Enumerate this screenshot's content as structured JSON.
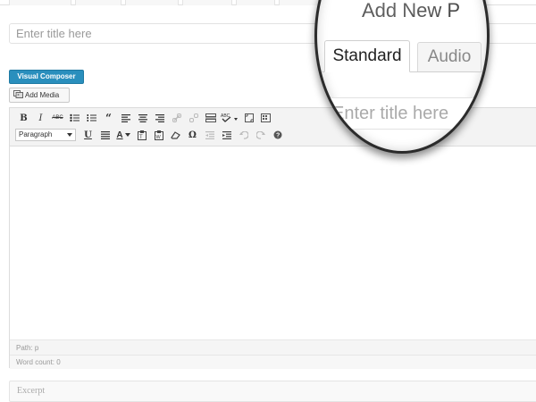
{
  "post": {
    "title_placeholder": "Enter title here",
    "visual_composer_label": "Visual Composer",
    "add_media_label": "Add Media"
  },
  "toolbar": {
    "row1": [
      "bold",
      "italic",
      "strikethrough",
      "bullet-list",
      "numbered-list",
      "blockquote",
      "align-left",
      "align-center",
      "align-right",
      "insert-link",
      "remove-link",
      "insert-more",
      "spellcheck",
      "fullscreen",
      "toolbar-toggle"
    ],
    "row2": [
      "format-select",
      "underline",
      "justify",
      "text-color",
      "paste-as-text",
      "paste-from-word",
      "clear-formatting",
      "special-character",
      "outdent",
      "indent",
      "undo",
      "redo",
      "help"
    ],
    "bold_label": "B",
    "italic_label": "I",
    "strike_label": "ABC",
    "underline_label": "U",
    "text_color_label": "A",
    "special_char_label": "Ω",
    "format_selected": "Paragraph"
  },
  "editor": {
    "path_text": "Path: p",
    "word_count_text": "Word count: 0"
  },
  "excerpt": {
    "placeholder": "Excerpt"
  },
  "magnifier": {
    "heading": "Add New P",
    "tabs": [
      "Standard",
      "Audio"
    ],
    "title_placeholder": "Enter title here"
  },
  "colors": {
    "visual_composer_bg": "#2a8fbd",
    "magnifier_border": "#2b2b2b"
  }
}
